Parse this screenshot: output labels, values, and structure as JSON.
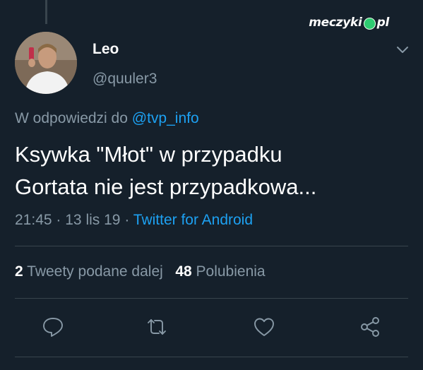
{
  "watermark": {
    "left": "meczyki",
    "right": "pl"
  },
  "author": {
    "display_name": "Leo",
    "handle": "@quuler3"
  },
  "reply": {
    "prefix": "W odpowiedzi do",
    "mention": "@tvp_info"
  },
  "tweet": {
    "line1": "Ksywka \"Młot\" w przypadku",
    "line2": "Gortata nie jest przypadkowa..."
  },
  "meta": {
    "time": "21:45",
    "date": "13 lis 19",
    "separator": "·",
    "source": "Twitter for Android"
  },
  "stats": {
    "retweets_count": "2",
    "retweets_label": "Tweety podane dalej",
    "likes_count": "48",
    "likes_label": "Polubienia"
  },
  "icons": {
    "reply": "reply-icon",
    "retweet": "retweet-icon",
    "like": "heart-icon",
    "share": "share-icon",
    "menu": "chevron-down-icon"
  },
  "colors": {
    "background": "#15202b",
    "accent": "#1da1f2",
    "secondary_text": "#8899a6",
    "divider": "#38444d"
  }
}
